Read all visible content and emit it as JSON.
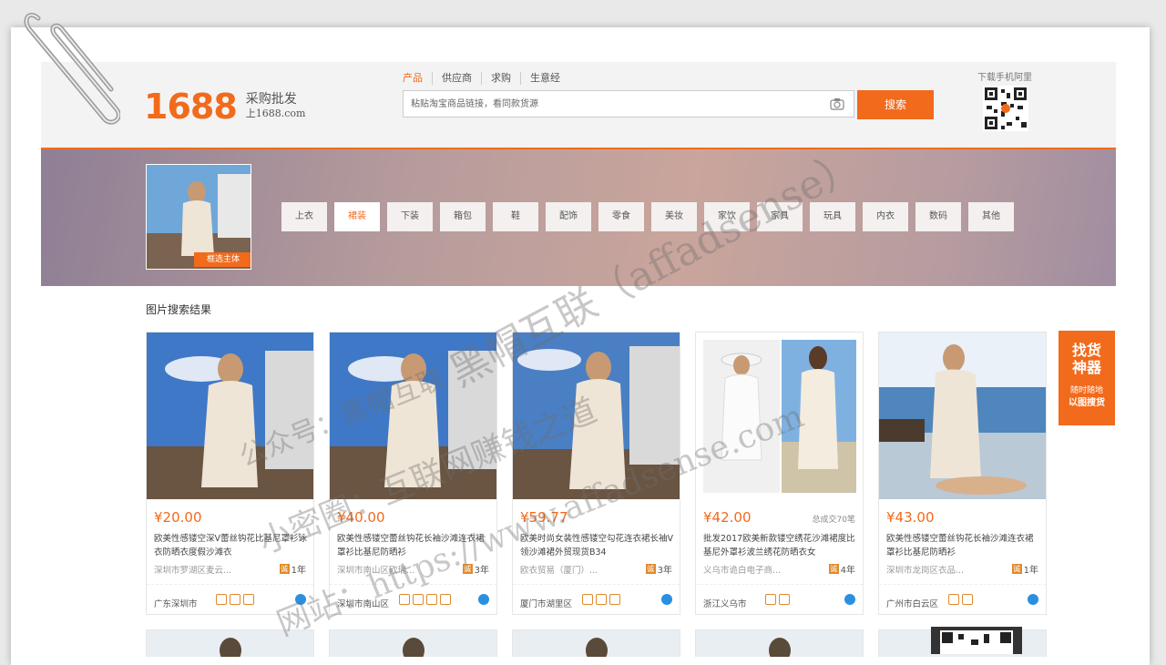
{
  "logo": {
    "number": "1688",
    "tagline": "采购批发",
    "domain": "上1688.com"
  },
  "search": {
    "tabs": [
      "产品",
      "供应商",
      "求购",
      "生意经"
    ],
    "active_tab": "产品",
    "placeholder": "粘贴淘宝商品链接，看同款货源",
    "button": "搜索"
  },
  "qr": {
    "label": "下载手机阿里"
  },
  "banner": {
    "thumb_button": "框选主体",
    "categories": [
      "上衣",
      "裙装",
      "下装",
      "箱包",
      "鞋",
      "配饰",
      "零食",
      "美妆",
      "家饮",
      "家具",
      "玩具",
      "内衣",
      "数码",
      "其他"
    ],
    "active_category": "裙装"
  },
  "results": {
    "title": "图片搜索结果",
    "items": [
      {
        "price": "¥20.00",
        "sold": "",
        "desc": "欧美性感镂空深V蕾丝钩花比基尼罩衫泳衣防晒衣度假沙滩衣",
        "company": "深圳市罗湖区麦云...",
        "years": "1年",
        "location": "广东深圳市"
      },
      {
        "price": "¥40.00",
        "sold": "",
        "desc": "欧美性感镂空蕾丝钩花长袖沙滩连衣裙罩衫比基尼防晒衫",
        "company": "深圳市南山区欧瑞...",
        "years": "3年",
        "location": "深圳市南山区"
      },
      {
        "price": "¥59.77",
        "sold": "",
        "desc": "欧美时尚女装性感镂空勾花连衣裙长袖V领沙滩裙外贸现货B34",
        "company": "欧衣贸易（厦门）...",
        "years": "3年",
        "location": "厦门市湖里区"
      },
      {
        "price": "¥42.00",
        "sold": "总成交70笔",
        "desc": "批发2017欧美新款镂空绣花沙滩裙度比基尼外罩衫波兰绣花防晒衣女",
        "company": "义乌市诡白电子商...",
        "years": "4年",
        "location": "浙江义乌市"
      },
      {
        "price": "¥43.00",
        "sold": "",
        "desc": "欧美性感镂空蕾丝钩花长袖沙滩连衣裙罩衫比基尼防晒衫",
        "company": "深圳市龙岗区衣品...",
        "years": "1年",
        "location": "广州市白云区"
      }
    ]
  },
  "float_panel": {
    "title": "找货神器",
    "line1": "随时随地",
    "line2": "以图搜货"
  },
  "watermarks": [
    "黑帽互联（affadsense）",
    "公众号：黑帽互联",
    "小密圈：互联网赚钱之道",
    "网站：https://www.affadsense.com"
  ]
}
